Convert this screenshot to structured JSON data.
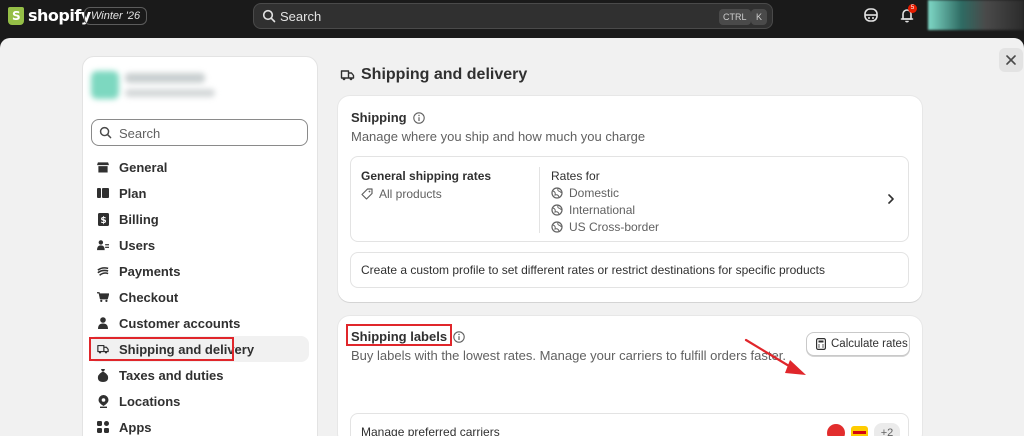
{
  "topbar": {
    "brand": "shopify",
    "edition": "Winter '26",
    "search_placeholder": "Search",
    "shortcut_ctrl": "CTRL",
    "shortcut_key": "K",
    "notification_count": "5"
  },
  "sidebar": {
    "search_placeholder": "Search",
    "items": [
      {
        "label": "General",
        "icon": "store-icon"
      },
      {
        "label": "Plan",
        "icon": "plan-icon"
      },
      {
        "label": "Billing",
        "icon": "billing-icon"
      },
      {
        "label": "Users",
        "icon": "users-icon"
      },
      {
        "label": "Payments",
        "icon": "payments-icon"
      },
      {
        "label": "Checkout",
        "icon": "cart-icon"
      },
      {
        "label": "Customer accounts",
        "icon": "person-icon"
      },
      {
        "label": "Shipping and delivery",
        "icon": "truck-icon",
        "active": true
      },
      {
        "label": "Taxes and duties",
        "icon": "money-bag-icon"
      },
      {
        "label": "Locations",
        "icon": "location-pin-icon"
      },
      {
        "label": "Apps",
        "icon": "apps-icon"
      }
    ]
  },
  "main": {
    "title": "Shipping and delivery",
    "shipping_card": {
      "title": "Shipping",
      "subtitle": "Manage where you ship and how much you charge",
      "rates_title": "General shipping rates",
      "products_label": "All products",
      "rates_for_label": "Rates for",
      "zones": [
        "Domestic",
        "International",
        "US Cross-border"
      ],
      "custom_profile_text": "Create a custom profile to set different rates or restrict destinations for specific products"
    },
    "labels_card": {
      "title": "Shipping labels",
      "subtitle": "Buy labels with the lowest rates. Manage your carriers to fulfill orders faster.",
      "calculate_button": "Calculate rates",
      "carriers_label": "Manage preferred carriers",
      "more_carriers": "+2"
    }
  },
  "colors": {
    "topbar_bg": "#1a1a1a",
    "page_bg": "#f1f1f1",
    "highlight_red": "#e0262b",
    "shopify_green": "#95bf47"
  }
}
